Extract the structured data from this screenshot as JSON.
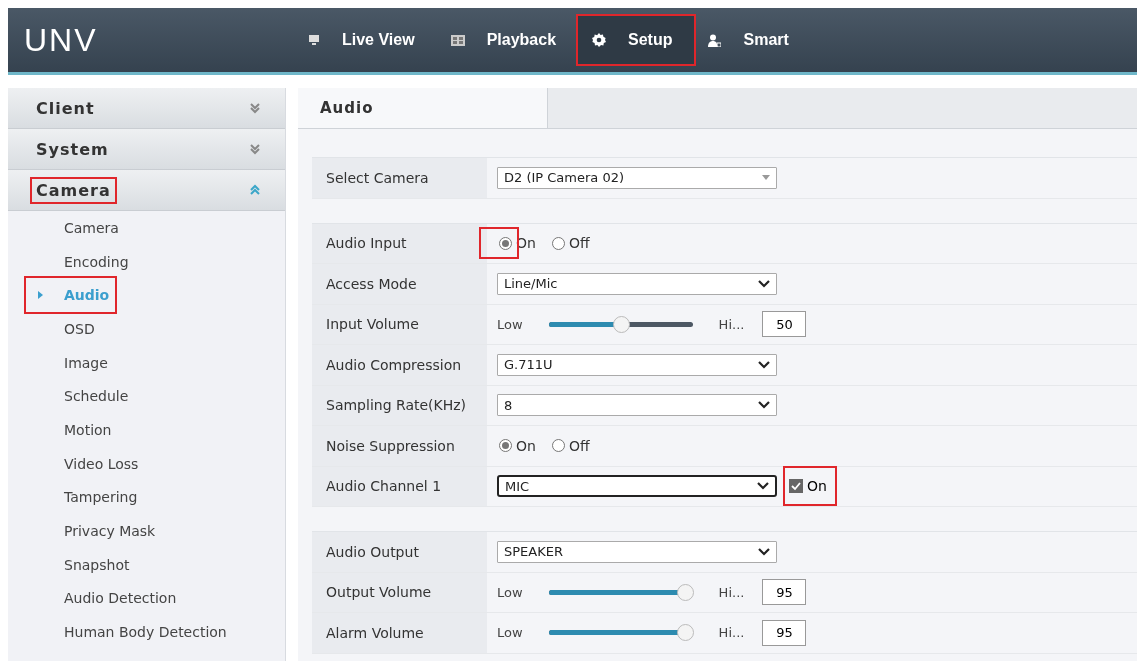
{
  "logo": "UNV",
  "nav": [
    {
      "label": "Live View",
      "selected": false,
      "highlighted": false
    },
    {
      "label": "Playback",
      "selected": false,
      "highlighted": false
    },
    {
      "label": "Setup",
      "selected": true,
      "highlighted": true
    },
    {
      "label": "Smart",
      "selected": false,
      "highlighted": false
    }
  ],
  "sidebar": {
    "groups": [
      {
        "label": "Client",
        "expanded": false,
        "highlighted": false
      },
      {
        "label": "System",
        "expanded": false,
        "highlighted": false
      },
      {
        "label": "Camera",
        "expanded": true,
        "highlighted": true,
        "children": [
          {
            "label": "Camera",
            "selected": false,
            "highlighted": false
          },
          {
            "label": "Encoding",
            "selected": false,
            "highlighted": false
          },
          {
            "label": "Audio",
            "selected": true,
            "highlighted": true
          },
          {
            "label": "OSD",
            "selected": false,
            "highlighted": false
          },
          {
            "label": "Image",
            "selected": false,
            "highlighted": false
          },
          {
            "label": "Schedule",
            "selected": false,
            "highlighted": false
          },
          {
            "label": "Motion",
            "selected": false,
            "highlighted": false
          },
          {
            "label": "Video Loss",
            "selected": false,
            "highlighted": false
          },
          {
            "label": "Tampering",
            "selected": false,
            "highlighted": false
          },
          {
            "label": "Privacy Mask",
            "selected": false,
            "highlighted": false
          },
          {
            "label": "Snapshot",
            "selected": false,
            "highlighted": false
          },
          {
            "label": "Audio Detection",
            "selected": false,
            "highlighted": false
          },
          {
            "label": "Human Body Detection",
            "selected": false,
            "highlighted": false
          }
        ]
      }
    ]
  },
  "tab": {
    "label": "Audio"
  },
  "sections": [
    [
      {
        "kind": "camera_select",
        "label": "Select Camera",
        "value": "D2 (IP Camera 02)"
      }
    ],
    [
      {
        "kind": "radio",
        "label": "Audio Input",
        "options": [
          {
            "label": "On",
            "selected": true,
            "highlighted": true
          },
          {
            "label": "Off",
            "selected": false,
            "highlighted": false
          }
        ]
      },
      {
        "kind": "select",
        "label": "Access Mode",
        "value": "Line/Mic"
      },
      {
        "kind": "slider",
        "label": "Input Volume",
        "low": "Low",
        "high": "Hi...",
        "level": 0.5,
        "value": "50"
      },
      {
        "kind": "select",
        "label": "Audio Compression",
        "value": "G.711U"
      },
      {
        "kind": "select",
        "label": "Sampling Rate(KHz)",
        "value": "8"
      },
      {
        "kind": "radio",
        "label": "Noise Suppression",
        "options": [
          {
            "label": "On",
            "selected": true,
            "highlighted": false
          },
          {
            "label": "Off",
            "selected": false,
            "highlighted": false
          }
        ]
      },
      {
        "kind": "select_check",
        "label": "Audio Channel 1",
        "value": "MIC",
        "focused": true,
        "check": {
          "label": "On",
          "checked": true,
          "highlighted": true
        }
      }
    ],
    [
      {
        "kind": "select",
        "label": "Audio Output",
        "value": "SPEAKER"
      },
      {
        "kind": "slider",
        "label": "Output Volume",
        "low": "Low",
        "high": "Hi...",
        "level": 0.95,
        "value": "95"
      },
      {
        "kind": "slider",
        "label": "Alarm Volume",
        "low": "Low",
        "high": "Hi...",
        "level": 0.95,
        "value": "95"
      }
    ]
  ]
}
